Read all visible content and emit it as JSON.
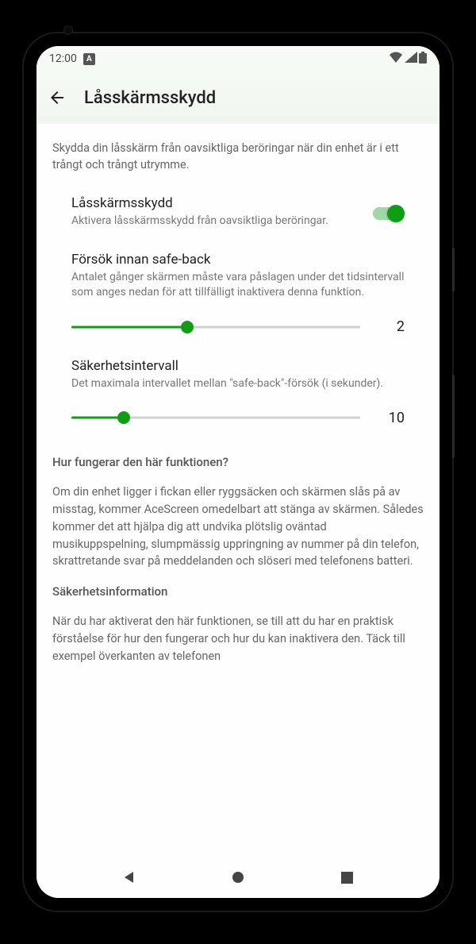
{
  "status": {
    "time": "12:00",
    "lang_indicator": "A"
  },
  "appbar": {
    "title": "Låsskärmsskydd"
  },
  "intro": "Skydda din låsskärm från oavsiktliga beröringar när din enhet är i ett trångt och trångt utrymme.",
  "settings": {
    "guard": {
      "title": "Låsskärmsskydd",
      "desc": "Aktivera låsskärmsskydd från oavsiktliga beröringar.",
      "enabled": true
    },
    "attempts": {
      "title": "Försök innan safe-back",
      "desc": "Antalet gånger skärmen måste vara påslagen under det tidsintervall som anges nedan för att tillfälligt inaktivera denna funktion.",
      "value": "2",
      "fill_pct": "40%"
    },
    "interval": {
      "title": "Säkerhetsintervall",
      "desc": "Det maximala intervallet mellan \"safe-back\"-försök (i sekunder).",
      "value": "10",
      "fill_pct": "18%"
    }
  },
  "info": {
    "heading1": "Hur fungerar den här funktionen?",
    "para1": "Om din enhet ligger i fickan eller ryggsäcken och skärmen slås på av misstag, kommer AceScreen omedelbart att stänga av skärmen. Således kommer det att hjälpa dig att undvika plötslig oväntad musikuppspelning, slumpmässig uppringning av nummer på din telefon, skrattretande svar på meddelanden och slöseri med telefonens batteri.",
    "heading2": "Säkerhetsinformation",
    "para2": "När du har aktiverat den här funktionen, se till att du har en praktisk förståelse för hur den fungerar och hur du kan inaktivera den. Täck till exempel överkanten av telefonen"
  },
  "colors": {
    "accent": "#0f9d14"
  }
}
